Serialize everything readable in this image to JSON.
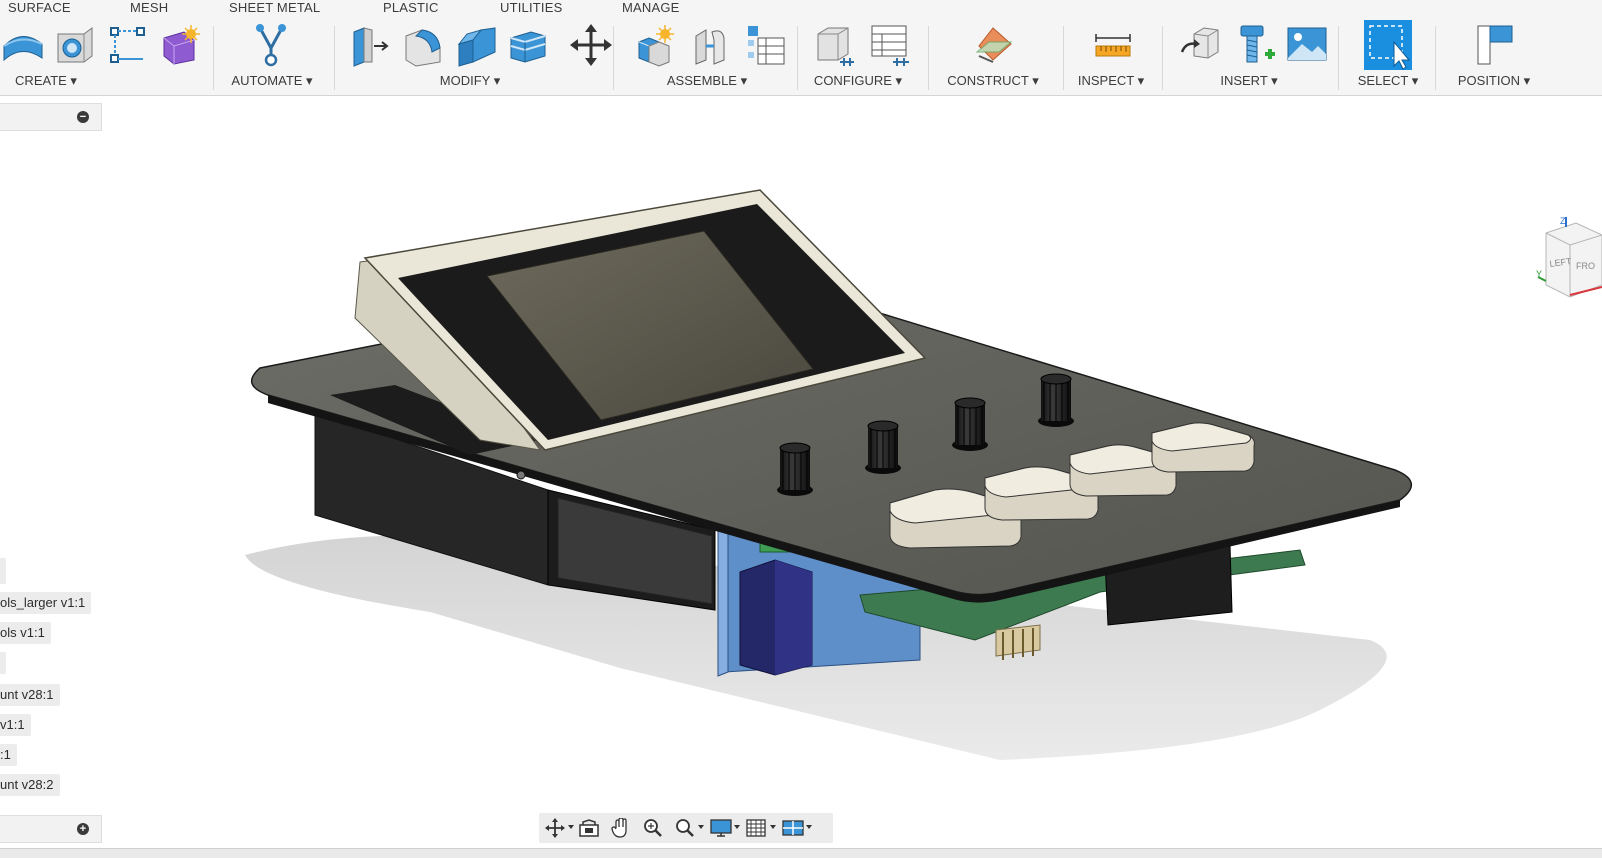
{
  "ribbon": {
    "tabs": [
      "SURFACE",
      "MESH",
      "SHEET METAL",
      "PLASTIC",
      "UTILITIES",
      "MANAGE"
    ],
    "groups": [
      "CREATE ▾",
      "AUTOMATE ▾",
      "MODIFY ▾",
      "ASSEMBLE ▾",
      "CONFIGURE ▾",
      "CONSTRUCT ▾",
      "INSPECT ▾",
      "INSERT ▾",
      "SELECT ▾",
      "POSITION ▾"
    ],
    "tool_icons": [
      "extrude-dome-icon",
      "hole-icon",
      "sketch-icon",
      "form-icon",
      "automate-icon",
      "press-pull-icon",
      "fillet-icon",
      "chamfer-icon",
      "shell-icon",
      "move-icon",
      "new-component-icon",
      "joint-icon",
      "bom-table-icon",
      "configure-cube-icon",
      "configure-table-icon",
      "construct-plane-icon",
      "measure-icon",
      "insert-derive-icon",
      "insert-mcmaster-icon",
      "insert-canvas-icon",
      "select-icon",
      "position-icon"
    ],
    "colors": {
      "accent": "#1e88d6",
      "select_active": "#1a8fe0"
    }
  },
  "browser": {
    "items": [
      "ols_larger v1:1",
      "ols v1:1",
      "unt v28:1",
      "v1:1",
      ":1",
      "unt v28:2"
    ],
    "header_icon": "collapse-minus-icon",
    "footer_icon": "expand-plus-icon"
  },
  "navbar": {
    "icons": [
      "orbit-icon",
      "look-at-icon",
      "pan-hand-icon",
      "zoom-icon",
      "zoom-window-icon",
      "display-settings-icon",
      "grid-settings-icon",
      "viewports-icon"
    ]
  },
  "viewcube": {
    "face_left": "LEFT",
    "face_front": "FRO",
    "axis_z": "Z",
    "axis_y": "Y"
  }
}
